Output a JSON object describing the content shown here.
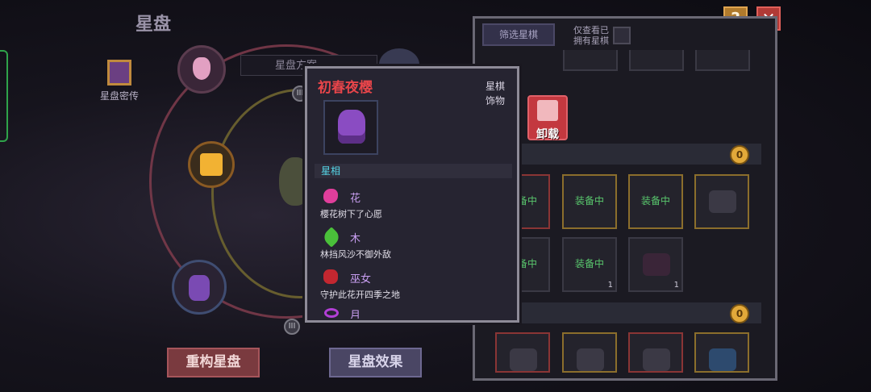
{
  "left": {
    "title": "星盘",
    "lore_label": "星盘密传",
    "preset_label": "星盘方案",
    "node_marker": "III",
    "rebuild_button": "重构星盘",
    "effect_button": "星盘效果"
  },
  "right": {
    "filter_button": "筛选星棋",
    "owned_only_line1": "仅查看已",
    "owned_only_line2": "拥有星棋",
    "help_label": "?",
    "close_label": "✕",
    "unequip_label": "卸载",
    "coin_label": "0",
    "equipped_tag": "装备中",
    "count_one": "1"
  },
  "tooltip": {
    "title": "初春夜樱",
    "type": "星棋",
    "subtype": "饰物",
    "section": "星相",
    "traits": [
      {
        "name": "花",
        "desc": "樱花树下了心愿",
        "icon": "flower-icon"
      },
      {
        "name": "木",
        "desc": "林挡风沙不御外敌",
        "icon": "wood-icon"
      },
      {
        "name": "巫女",
        "desc": "守护此花开四季之地",
        "icon": "miko-icon"
      },
      {
        "name": "月",
        "desc": "",
        "icon": "moon-icon"
      }
    ]
  },
  "colors": {
    "title_red": "#e8454a",
    "trait_purple": "#c99ff2",
    "section_cyan": "#56d7e9",
    "equipped_green": "#59c76d"
  }
}
